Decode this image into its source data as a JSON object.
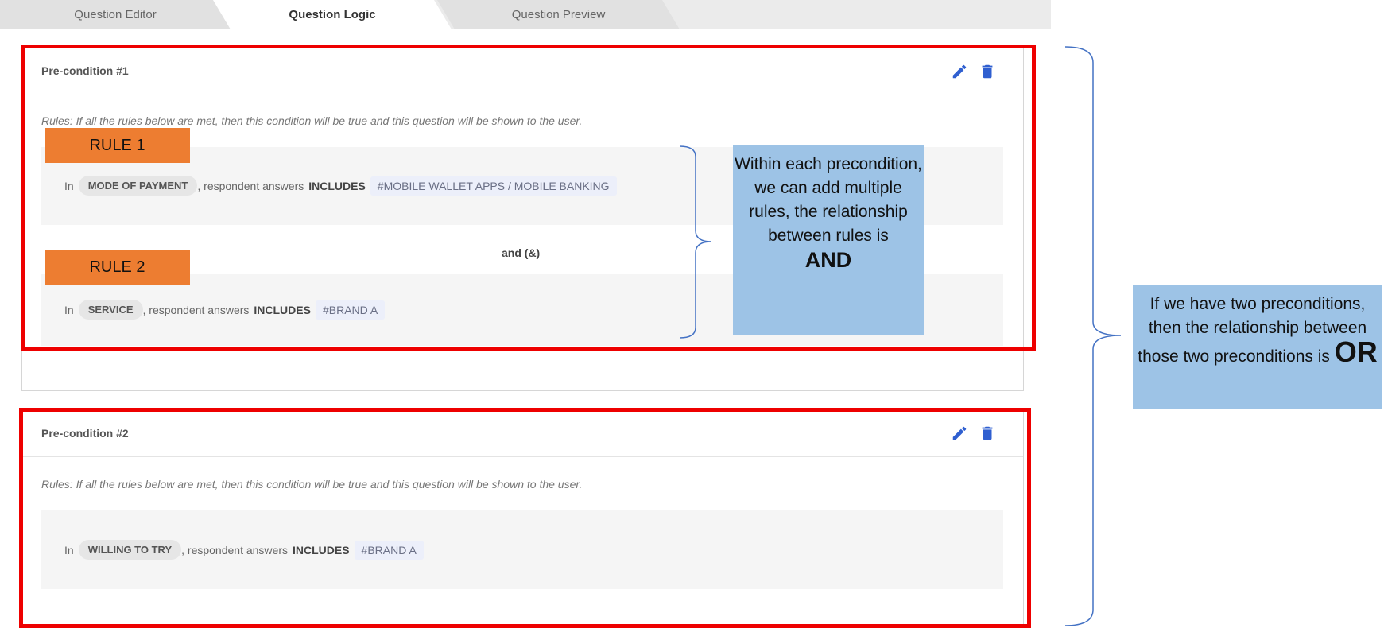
{
  "tabs": [
    {
      "label": "Question Editor",
      "active": false
    },
    {
      "label": "Question Logic",
      "active": true
    },
    {
      "label": "Question Preview",
      "active": false
    }
  ],
  "preconditions": [
    {
      "title": "Pre-condition #1",
      "rules_text": "Rules: If all the rules below are met, then this condition will be true and this question will be shown to the user.",
      "rules": [
        {
          "prefix": "In",
          "question": "MODE OF PAYMENT",
          "middle": ", respondent answers",
          "operator": "INCLUDES",
          "answer": "#MOBILE WALLET APPS / MOBILE BANKING"
        },
        {
          "prefix": "In",
          "question": "SERVICE",
          "middle": ", respondent answers",
          "operator": "INCLUDES",
          "answer": "#BRAND A"
        }
      ],
      "connector": "and (&)"
    },
    {
      "title": "Pre-condition #2",
      "rules_text": "Rules: If all the rules below are met, then this condition will be true and this question will be shown to the user.",
      "rules": [
        {
          "prefix": "In",
          "question": "WILLING TO TRY",
          "middle": ", respondent answers",
          "operator": "INCLUDES",
          "answer": "#BRAND A"
        }
      ]
    }
  ],
  "icons": {
    "edit": "pencil-icon",
    "delete": "trash-icon"
  },
  "annotations": {
    "rule_badges": [
      "RULE 1",
      "RULE 2"
    ],
    "callout_and": {
      "text": "Within each precondition, we can add multiple rules, the relationship between rules is",
      "emphasis": "AND"
    },
    "callout_or": {
      "text": "If we have two preconditions, then the relationship between those two preconditions is",
      "emphasis": "OR"
    }
  },
  "colors": {
    "highlight_box": "#ee0000",
    "rule_badge": "#ed7d31",
    "callout": "#9dc3e6",
    "brace": "#4472c4",
    "icon": "#2f5fd0"
  }
}
